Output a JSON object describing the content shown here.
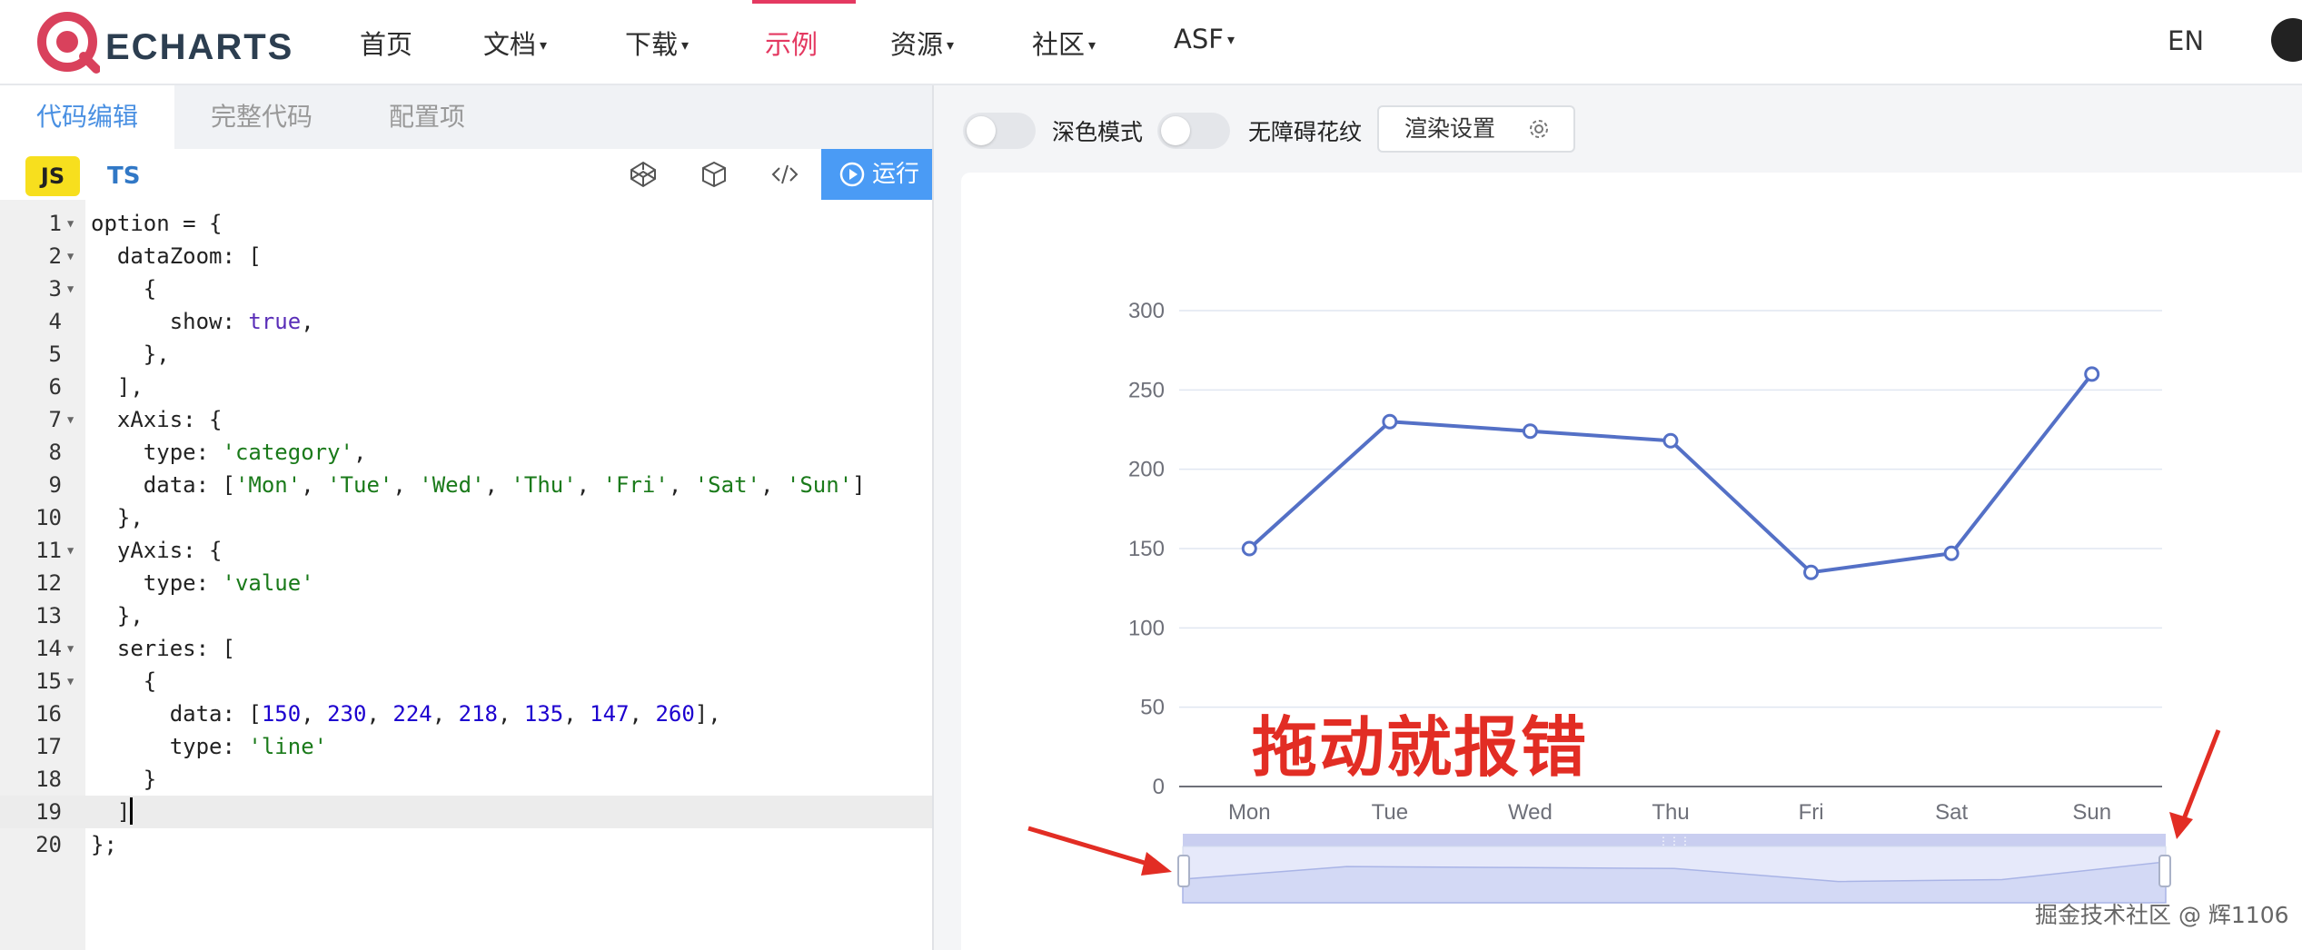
{
  "nav": {
    "logo_text": "ECHARTS",
    "items": [
      {
        "label": "首页",
        "caret": false
      },
      {
        "label": "文档",
        "caret": true
      },
      {
        "label": "下载",
        "caret": true
      },
      {
        "label": "示例",
        "caret": false,
        "active": true
      },
      {
        "label": "资源",
        "caret": true
      },
      {
        "label": "社区",
        "caret": true
      },
      {
        "label": "ASF",
        "caret": true
      }
    ],
    "lang": "EN",
    "accent_color": "#e43961"
  },
  "editor": {
    "tabs": [
      {
        "label": "代码编辑",
        "active": true
      },
      {
        "label": "完整代码",
        "active": false
      },
      {
        "label": "配置项",
        "active": false
      }
    ],
    "lang_js": "JS",
    "lang_ts": "TS",
    "tool_icons": [
      "codepen-icon",
      "codesandbox-icon",
      "code-icon"
    ],
    "run_label": "运行",
    "current_line": 19,
    "lines": [
      [
        [
          "option = {",
          ""
        ]
      ],
      [
        [
          "  dataZoom: [",
          ""
        ]
      ],
      [
        [
          "    {",
          ""
        ]
      ],
      [
        [
          "      show: ",
          ""
        ],
        [
          "true",
          "bool"
        ],
        [
          ",",
          ""
        ]
      ],
      [
        [
          "    },",
          ""
        ]
      ],
      [
        [
          "  ],",
          ""
        ]
      ],
      [
        [
          "  xAxis: {",
          ""
        ]
      ],
      [
        [
          "    type: ",
          ""
        ],
        [
          "'category'",
          "str"
        ],
        [
          ",",
          ""
        ]
      ],
      [
        [
          "    data: [",
          ""
        ],
        [
          "'Mon'",
          "str"
        ],
        [
          ", ",
          ""
        ],
        [
          "'Tue'",
          "str"
        ],
        [
          ", ",
          ""
        ],
        [
          "'Wed'",
          "str"
        ],
        [
          ", ",
          ""
        ],
        [
          "'Thu'",
          "str"
        ],
        [
          ", ",
          ""
        ],
        [
          "'Fri'",
          "str"
        ],
        [
          ", ",
          ""
        ],
        [
          "'Sat'",
          "str"
        ],
        [
          ", ",
          ""
        ],
        [
          "'Sun'",
          "str"
        ],
        [
          "]",
          ""
        ]
      ],
      [
        [
          "  },",
          ""
        ]
      ],
      [
        [
          "  yAxis: {",
          ""
        ]
      ],
      [
        [
          "    type: ",
          ""
        ],
        [
          "'value'",
          "str"
        ]
      ],
      [
        [
          "  },",
          ""
        ]
      ],
      [
        [
          "  series: [",
          ""
        ]
      ],
      [
        [
          "    {",
          ""
        ]
      ],
      [
        [
          "      data: [",
          ""
        ],
        [
          "150",
          "num"
        ],
        [
          ", ",
          ""
        ],
        [
          "230",
          "num"
        ],
        [
          ", ",
          ""
        ],
        [
          "224",
          "num"
        ],
        [
          ", ",
          ""
        ],
        [
          "218",
          "num"
        ],
        [
          ", ",
          ""
        ],
        [
          "135",
          "num"
        ],
        [
          ", ",
          ""
        ],
        [
          "147",
          "num"
        ],
        [
          ", ",
          ""
        ],
        [
          "260",
          "num"
        ],
        [
          "],",
          ""
        ]
      ],
      [
        [
          "      type: ",
          ""
        ],
        [
          "'line'",
          "str"
        ]
      ],
      [
        [
          "    }",
          ""
        ]
      ],
      [
        [
          "  ]",
          ""
        ]
      ],
      [
        [
          "};",
          ""
        ]
      ]
    ],
    "fold_lines": [
      1,
      2,
      3,
      7,
      11,
      14,
      15
    ]
  },
  "preview": {
    "dark_mode_label": "深色模式",
    "aria_label": "无障碍花纹",
    "render_settings_label": "渲染设置",
    "annotation_text": "拖动就报错",
    "site_watermark": "掘金技术社区 @ 辉1106"
  },
  "chart_data": {
    "type": "line",
    "categories": [
      "Mon",
      "Tue",
      "Wed",
      "Thu",
      "Fri",
      "Sat",
      "Sun"
    ],
    "series": [
      {
        "values": [
          150,
          230,
          224,
          218,
          135,
          147,
          260
        ]
      }
    ],
    "ylim": [
      0,
      300
    ],
    "yticks": [
      0,
      50,
      100,
      150,
      200,
      250,
      300
    ],
    "grid": true,
    "datazoom": true,
    "line_color": "#5470c6",
    "annotation_color": "#e22d24"
  }
}
